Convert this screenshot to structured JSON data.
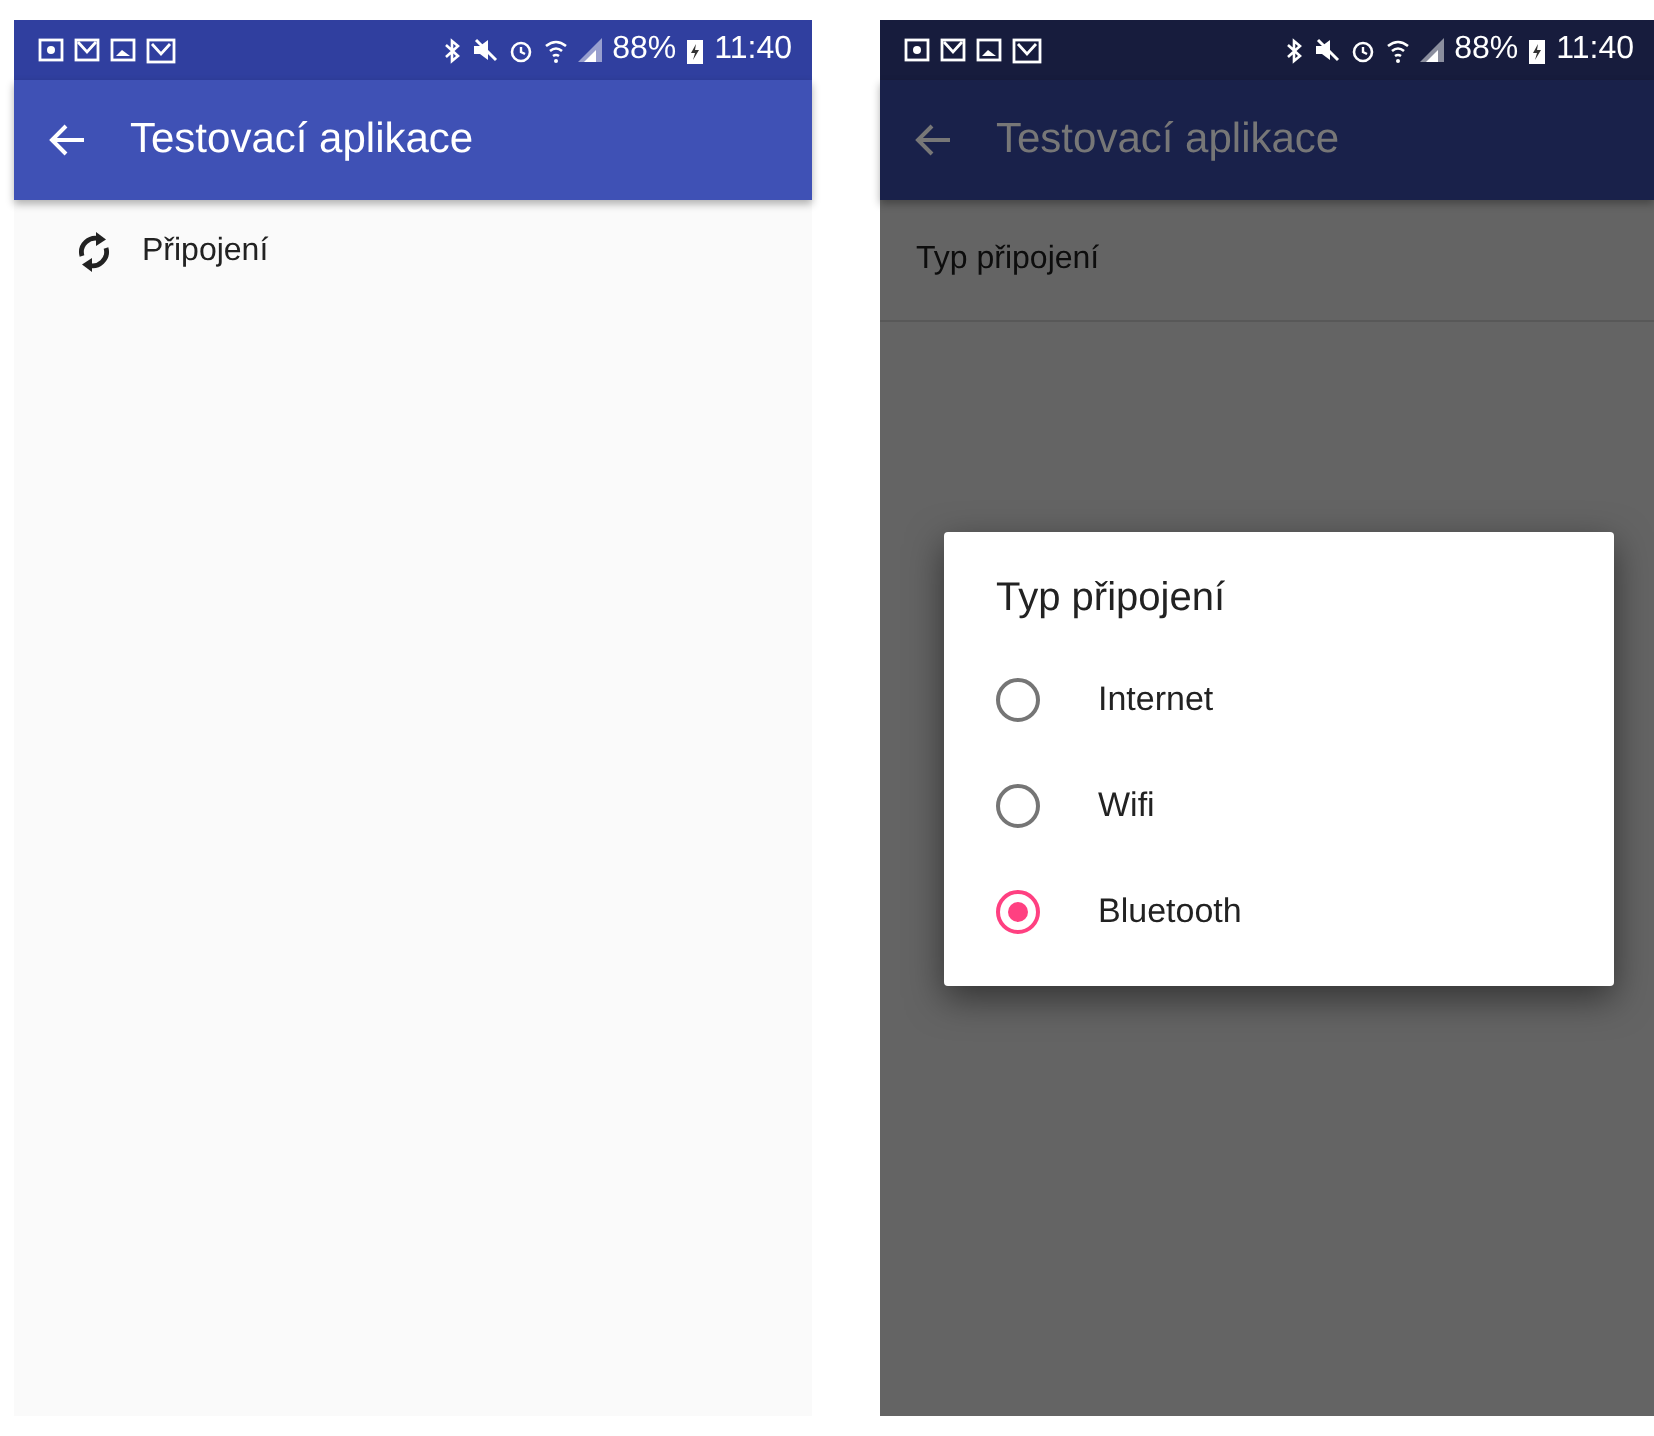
{
  "screens": [
    {
      "status_bar": {
        "battery": "88%",
        "time": "11:40"
      },
      "app_bar": {
        "title": "Testovací aplikace"
      },
      "list": [
        {
          "kind": "icon-row",
          "label": "Připojení"
        }
      ],
      "dimmed": false
    },
    {
      "status_bar": {
        "battery": "88%",
        "time": "11:40"
      },
      "app_bar": {
        "title": "Testovací aplikace"
      },
      "list": [
        {
          "kind": "plain-row",
          "label": "Typ připojení"
        }
      ],
      "dimmed": true,
      "dialog": {
        "title": "Typ připojení",
        "options": [
          {
            "label": "Internet",
            "selected": false
          },
          {
            "label": "Wifi",
            "selected": false
          },
          {
            "label": "Bluetooth",
            "selected": true
          }
        ]
      }
    }
  ]
}
